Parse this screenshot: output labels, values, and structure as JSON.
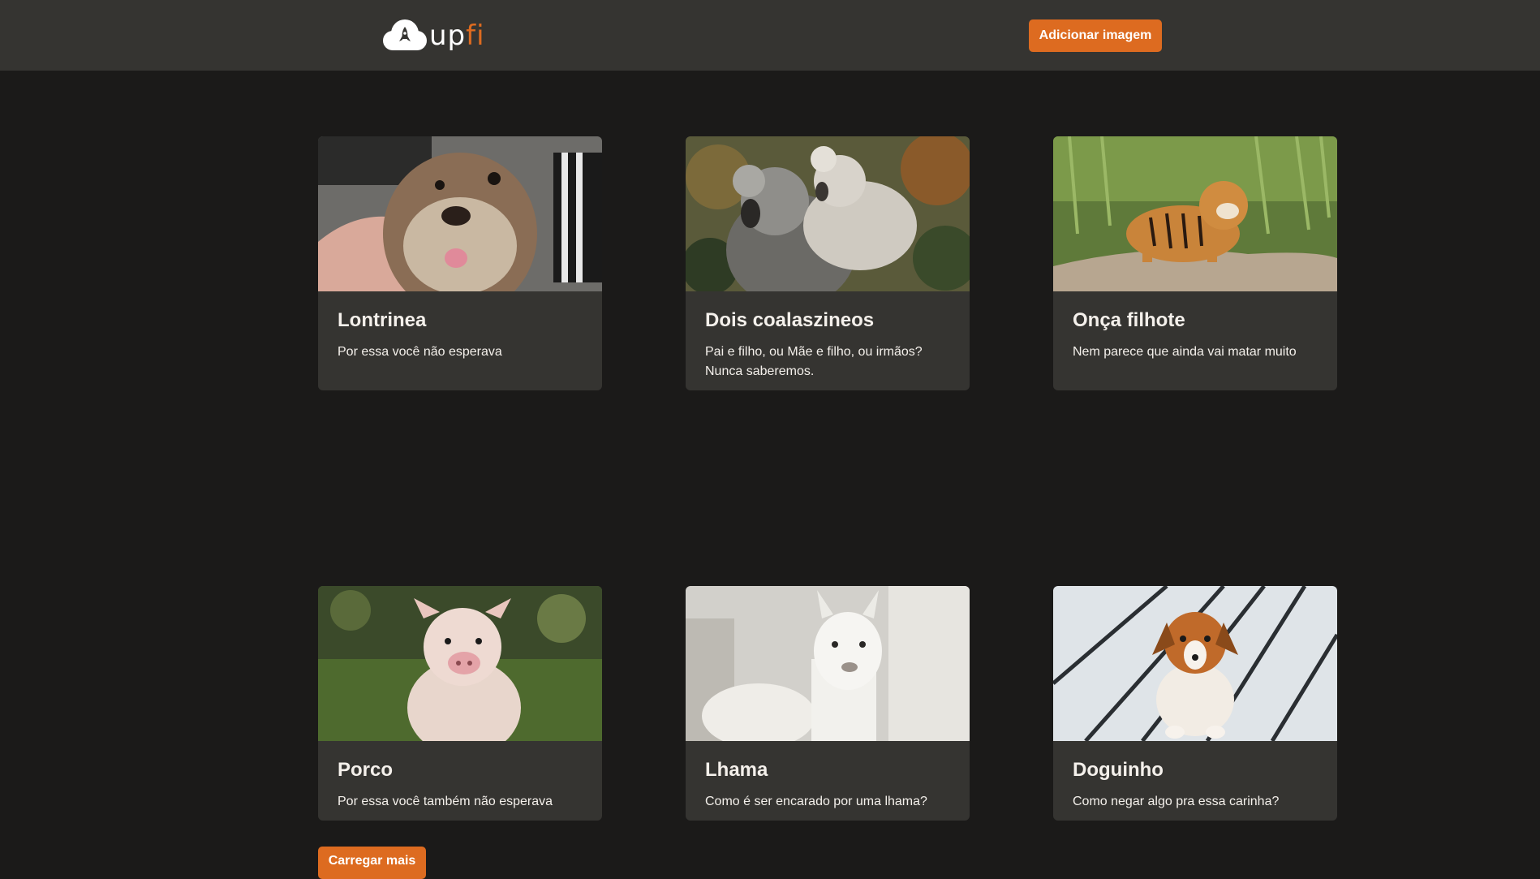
{
  "header": {
    "logo_up": "up",
    "logo_fi": "fi",
    "add_button_label": "Adicionar imagem"
  },
  "cards": [
    {
      "title": "Lontrinea",
      "description": "Por essa você não esperava",
      "image": "otter-photo"
    },
    {
      "title": "Dois coalaszineos",
      "description": "Pai e filho, ou Mãe e filho, ou irmãos? Nunca saberemos.",
      "image": "koala-photo"
    },
    {
      "title": "Onça filhote",
      "description": "Nem parece que ainda vai matar muito",
      "image": "tiger-cub-photo"
    },
    {
      "title": "Porco",
      "description": "Por essa você também não esperava",
      "image": "piglet-photo"
    },
    {
      "title": "Lhama",
      "description": "Como é ser encarado por uma lhama?",
      "image": "llama-photo"
    },
    {
      "title": "Doguinho",
      "description": "Como negar algo pra essa carinha?",
      "image": "puppy-photo"
    }
  ],
  "load_more_label": "Carregar mais",
  "colors": {
    "background": "#1b1a19",
    "surface": "#353431",
    "accent": "#dd6b20",
    "text": "#f4f0eb"
  }
}
